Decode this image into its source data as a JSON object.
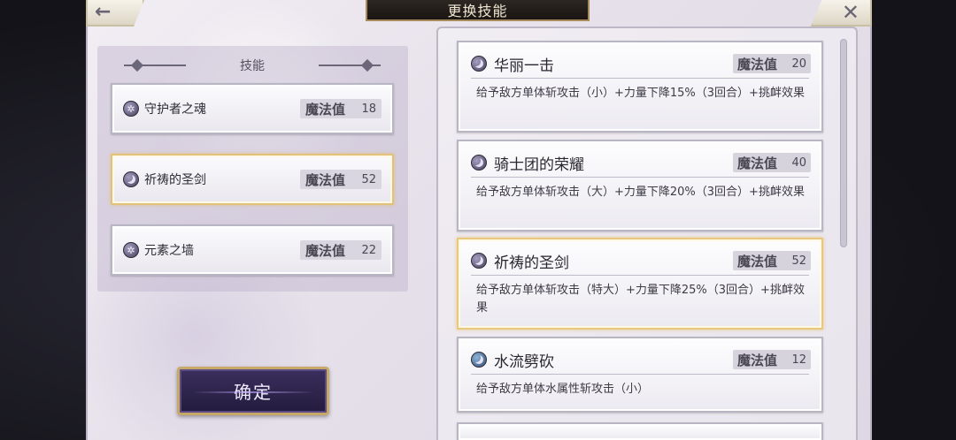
{
  "header": {
    "title": "更换技能",
    "back_icon": "←",
    "close_icon": "✕"
  },
  "equipped": {
    "heading": "技能",
    "items": [
      {
        "name": "守护者之魂",
        "mp_label": "魔法值",
        "mp": "18",
        "icon": "snowflake-icon",
        "selected": false
      },
      {
        "name": "祈祷的圣剑",
        "mp_label": "魔法值",
        "mp": "52",
        "icon": "moon-icon",
        "selected": true
      },
      {
        "name": "元素之墙",
        "mp_label": "魔法值",
        "mp": "22",
        "icon": "snowflake-icon",
        "selected": false
      }
    ]
  },
  "confirm_label": "确定",
  "skill_list": [
    {
      "name": "华丽一击",
      "mp_label": "魔法值",
      "mp": "20",
      "icon": "moon-icon",
      "desc": "给予敌方单体斩攻击（小）+力量下降15%（3回合）+挑衅效果",
      "selected": false
    },
    {
      "name": "骑士团的荣耀",
      "mp_label": "魔法值",
      "mp": "40",
      "icon": "moon-icon",
      "desc": "给予敌方单体斩攻击（大）+力量下降20%（3回合）+挑衅效果",
      "selected": false
    },
    {
      "name": "祈祷的圣剑",
      "mp_label": "魔法值",
      "mp": "52",
      "icon": "moon-icon",
      "desc": "给予敌方单体斩攻击（特大）+力量下降25%（3回合）+挑衅效果",
      "selected": true
    },
    {
      "name": "水流劈砍",
      "mp_label": "魔法值",
      "mp": "12",
      "icon": "water-icon",
      "desc": "给予敌方单体水属性斩攻击（小）",
      "selected": false
    }
  ],
  "colors": {
    "selected_border": "#e8c77e",
    "banner_bg": "#1a1512",
    "confirm_bg": "#2c2448"
  }
}
